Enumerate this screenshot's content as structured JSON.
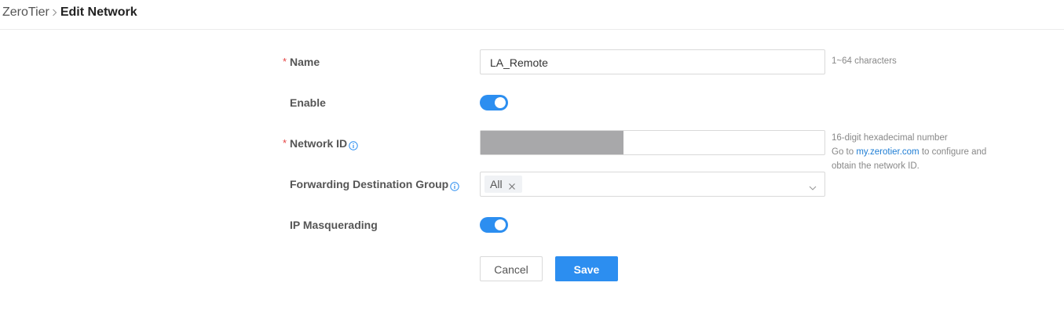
{
  "breadcrumb": {
    "root": "ZeroTier",
    "current": "Edit Network"
  },
  "form": {
    "name": {
      "label": "Name",
      "required_mark": "*",
      "value": "LA_Remote",
      "hint": "1~64 characters"
    },
    "enable": {
      "label": "Enable",
      "on": true
    },
    "network_id": {
      "label": "Network ID",
      "required_mark": "*",
      "hint_line1": "16-digit hexadecimal number",
      "hint_line2_prefix": "Go to ",
      "hint_link": "my.zerotier.com",
      "hint_line2_suffix": " to configure and",
      "hint_line3": "obtain the network ID."
    },
    "forwarding_group": {
      "label": "Forwarding Destination Group",
      "selected_tag": "All"
    },
    "ip_masquerading": {
      "label": "IP Masquerading",
      "on": true
    }
  },
  "actions": {
    "cancel_label": "Cancel",
    "save_label": "Save"
  },
  "colors": {
    "accent": "#2c8ef0",
    "required": "#e54545",
    "link": "#1e7dd4"
  },
  "icons": {
    "breadcrumb_separator": "chevron-right-icon",
    "info": "info-icon",
    "tag_remove": "close-icon",
    "dropdown": "chevron-down-icon"
  }
}
